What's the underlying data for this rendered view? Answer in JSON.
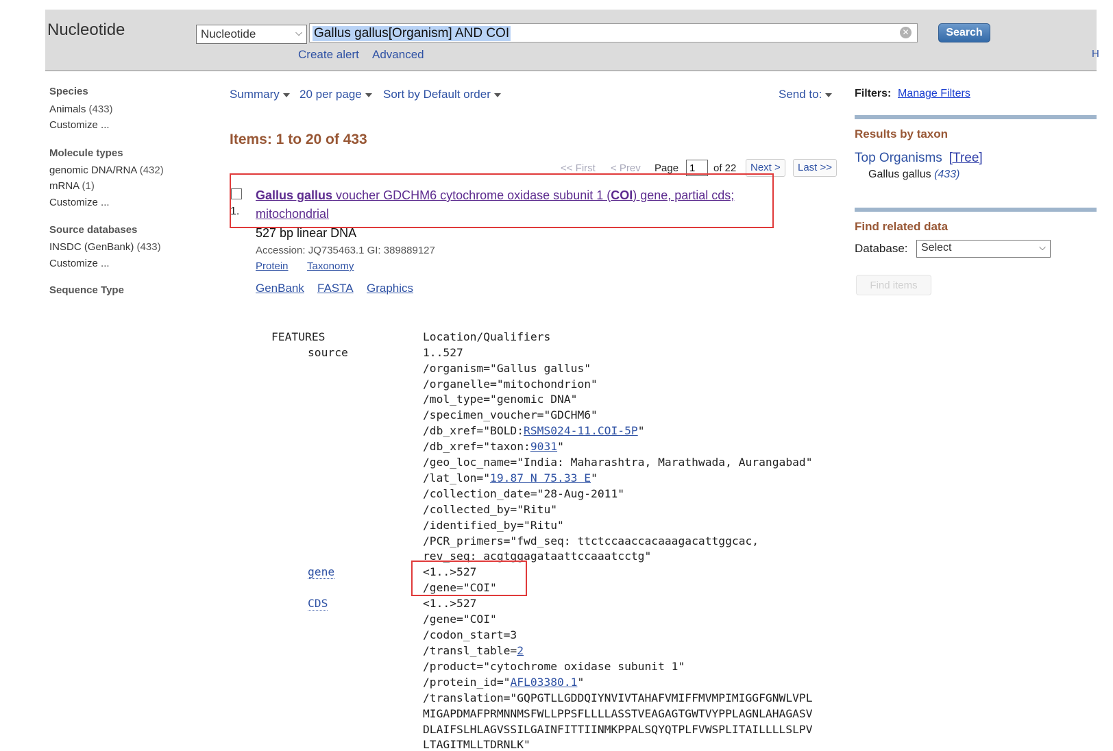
{
  "header": {
    "db_title": "Nucleotide",
    "db_select": "Nucleotide",
    "search_query": "Gallus gallus[Organism] AND COI",
    "search_button": "Search",
    "create_alert": "Create alert",
    "advanced": "Advanced",
    "help_cut": "H"
  },
  "sidebar": {
    "species_heading": "Species",
    "species_items": [
      {
        "label": "Animals",
        "count": "(433)"
      }
    ],
    "species_customize": "Customize ...",
    "molecule_heading": "Molecule types",
    "molecule_items": [
      {
        "label": "genomic DNA/RNA",
        "count": "(432)"
      },
      {
        "label": "mRNA",
        "count": "(1)"
      }
    ],
    "molecule_customize": "Customize ...",
    "source_heading": "Source databases",
    "source_items": [
      {
        "label": "INSDC (GenBank)",
        "count": "(433)"
      }
    ],
    "source_customize": "Customize ...",
    "seqtype_heading": "Sequence Type"
  },
  "controls": {
    "summary": "Summary",
    "per_page": "20 per page",
    "sort": "Sort by Default order",
    "send_to": "Send to:"
  },
  "results": {
    "items_count": "Items: 1 to 20 of 433",
    "pager": {
      "first": "<< First",
      "prev": "< Prev",
      "page_label": "Page",
      "page_value": "1",
      "of_pages": "of 22",
      "next": "Next >",
      "last": "Last >>"
    },
    "item": {
      "number": "1.",
      "title_bold_1": "Gallus gallus",
      "title_part_2": " voucher GDCHM6 cytochrome oxidase subunit 1 (",
      "title_bold_2": "COI",
      "title_part_3": ") gene, partial cds;",
      "title_line_2": "mitochondrial",
      "meta": "527 bp linear DNA",
      "accession": "Accession: JQ735463.1   GI: 389889127",
      "links": [
        "Protein",
        "Taxonomy"
      ],
      "format_links": [
        "GenBank",
        "FASTA",
        "Graphics"
      ]
    }
  },
  "right_panel": {
    "filters_label": "Filters:",
    "manage_filters": "Manage Filters",
    "results_by_taxon": "Results by taxon",
    "top_organisms": "Top Organisms",
    "tree": "[Tree]",
    "organism": "Gallus gallus",
    "organism_count": "(433)",
    "find_related": "Find related data",
    "database_label": "Database:",
    "database_select": "Select",
    "find_items": "Find items"
  },
  "features": {
    "header_key": "FEATURES",
    "header_val": "Location/Qualifiers",
    "source_key": "source",
    "source_lines": [
      "1..527",
      "/organism=\"Gallus gallus\"",
      "/organelle=\"mitochondrion\"",
      "/mol_type=\"genomic DNA\"",
      "/specimen_voucher=\"GDCHM6\""
    ],
    "bold_pre": "/db_xref=\"BOLD:",
    "bold_link": "RSMS024-11.COI-5P",
    "bold_post": "\"",
    "taxon_pre": "/db_xref=\"taxon:",
    "taxon_link": "9031",
    "taxon_post": "\"",
    "geo": "/geo_loc_name=\"India: Maharashtra, Marathwada, Aurangabad\"",
    "latlon_pre": "/lat_lon=\"",
    "latlon_link": "19.87 N 75.33 E",
    "latlon_post": "\"",
    "more_lines": [
      "/collection_date=\"28-Aug-2011\"",
      "/collected_by=\"Ritu\"",
      "/identified_by=\"Ritu\"",
      "/PCR_primers=\"fwd_seq: ttctccaaccacaaagacattggcac,",
      "rev_seq: acgtggagataattccaaatcctg\""
    ],
    "gene_key": "gene",
    "gene_lines": [
      "<1..>527",
      "/gene=\"COI\""
    ],
    "cds_key": "CDS",
    "cds_lines": [
      "<1..>527",
      "/gene=\"COI\"",
      "/codon_start=3"
    ],
    "transl_pre": "/transl_table=",
    "transl_link": "2",
    "product": "/product=\"cytochrome oxidase subunit 1\"",
    "protein_pre": "/protein_id=\"",
    "protein_link": "AFL03380.1",
    "protein_post": "\"",
    "translation_lines": [
      "/translation=\"GQPGTLLGDDQIYNVIVTAHAFVMIFFMVMPIMIGGFGNWLVPL",
      "MIGAPDMAFPRMNNMSFWLLPPSFLLLLASSTVEAGAGTGWTVYPPLAGNLAHAGASV",
      "DLAIFSLHLAGVSSILGAINFITTIINMKPPALSQYQTPLFVWSPLITAILLLLSLPV",
      "LTAGITMLLTDRNLK\""
    ]
  },
  "colors": {
    "header_bg": "#dcdcdc",
    "link_blue": "#2f52a4",
    "visited_purple": "#5d2c8f",
    "heading_brown": "#985735",
    "annotation_red": "#e03a3a"
  }
}
